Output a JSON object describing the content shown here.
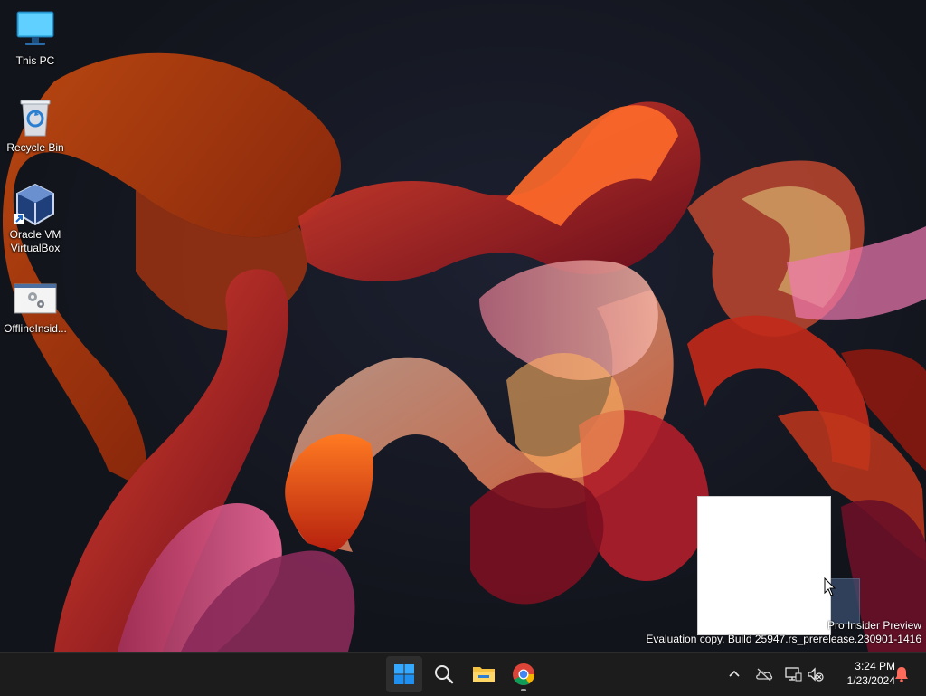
{
  "desktop": {
    "icons": [
      {
        "label": "This PC"
      },
      {
        "label": "Recycle Bin"
      },
      {
        "label": "Oracle VM\nVirtualBox"
      },
      {
        "label": "OfflineInsid..."
      }
    ],
    "watermark": {
      "line1": "Pro Insider Preview",
      "line2": "Evaluation copy. Build 25947.rs_prerelease.230901-1416"
    }
  },
  "taskbar": {
    "apps": [
      "start-icon",
      "search-icon",
      "file-explorer-icon",
      "chrome-icon"
    ],
    "tray": [
      "chevron-up-icon",
      "onedrive-icon",
      "network-icon",
      "volume-muted-icon"
    ],
    "clock": {
      "time": "3:24 PM",
      "date": "1/23/2024"
    },
    "notification_color": "#ff6b5a"
  },
  "colors": {
    "taskbar_bg": "#1c1c1c",
    "accent": "#2d9cff"
  }
}
